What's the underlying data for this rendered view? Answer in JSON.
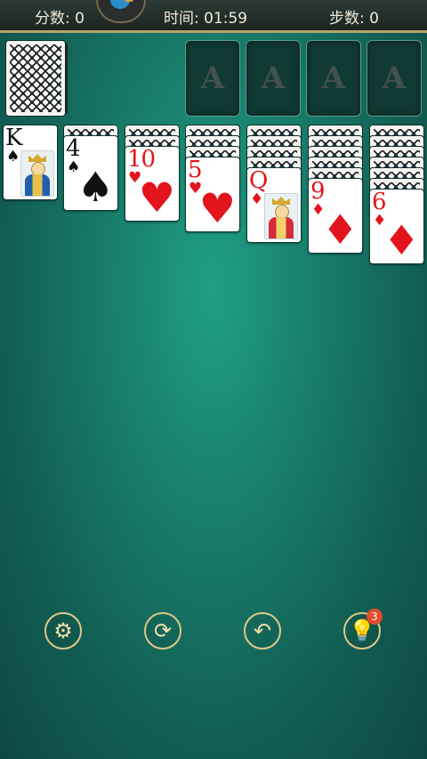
{
  "header": {
    "score": "分数: 0",
    "time": "时间: 01:59",
    "moves": "步数: 0"
  },
  "foundations": [
    {
      "label": "A"
    },
    {
      "label": "A"
    },
    {
      "label": "A"
    },
    {
      "label": "A"
    }
  ],
  "tableau": [
    {
      "rank": "K",
      "suit": "♠",
      "color": "black",
      "face": "king"
    },
    {
      "rank": "4",
      "suit": "♠",
      "color": "black"
    },
    {
      "rank": "10",
      "suit": "♥",
      "color": "red"
    },
    {
      "rank": "5",
      "suit": "♥",
      "color": "red"
    },
    {
      "rank": "Q",
      "suit": "♦",
      "color": "red",
      "face": "queen"
    },
    {
      "rank": "9",
      "suit": "♦",
      "color": "red"
    },
    {
      "rank": "6",
      "suit": "♦",
      "color": "red"
    }
  ],
  "toolbar": {
    "hint_count": "3"
  },
  "icons": {
    "settings": "gear-icon",
    "refresh": "refresh-icon",
    "undo": "undo-icon",
    "hint": "lightbulb-icon"
  },
  "colors": {
    "felt": "#187d6a",
    "accent": "#e0c98a",
    "red_suit": "#e3141b",
    "badge": "#e24b2b"
  }
}
